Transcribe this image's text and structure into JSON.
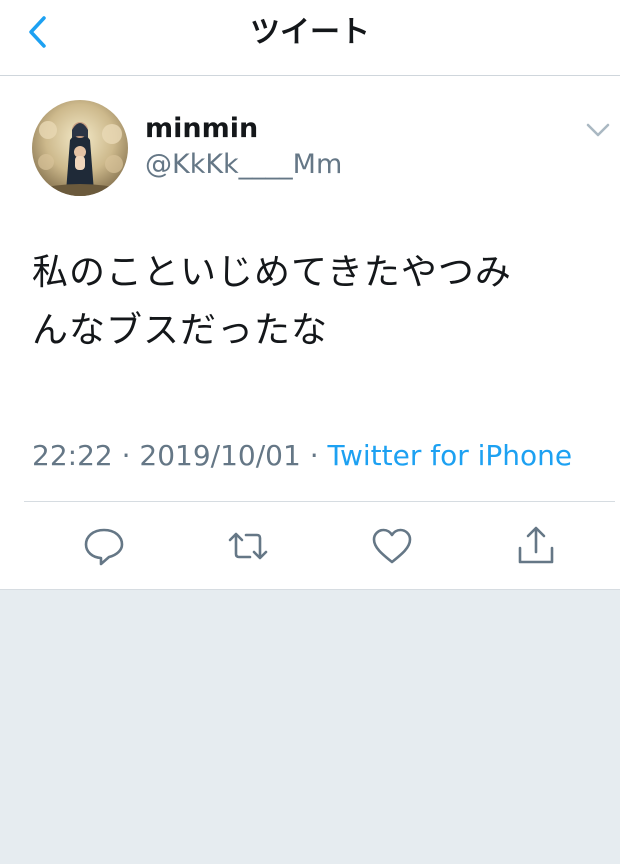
{
  "nav": {
    "title": "ツイート",
    "back_icon": "chevron-left-icon"
  },
  "tweet": {
    "display_name": "minmin",
    "handle": "@KkKk____Mm",
    "text_line1": "私のこといじめてきたやつみ",
    "text_line2": "んなブスだったな",
    "time": "22:22",
    "separator": " · ",
    "date": "2019/10/01",
    "source": "Twitter for iPhone"
  },
  "actions": [
    {
      "name": "reply",
      "icon": "reply-icon"
    },
    {
      "name": "retweet",
      "icon": "retweet-icon"
    },
    {
      "name": "like",
      "icon": "heart-icon"
    },
    {
      "name": "share",
      "icon": "share-icon"
    }
  ],
  "colors": {
    "accent": "#1da1f2",
    "text": "#14171a",
    "secondary": "#657786",
    "background": "#e6ecf0"
  }
}
